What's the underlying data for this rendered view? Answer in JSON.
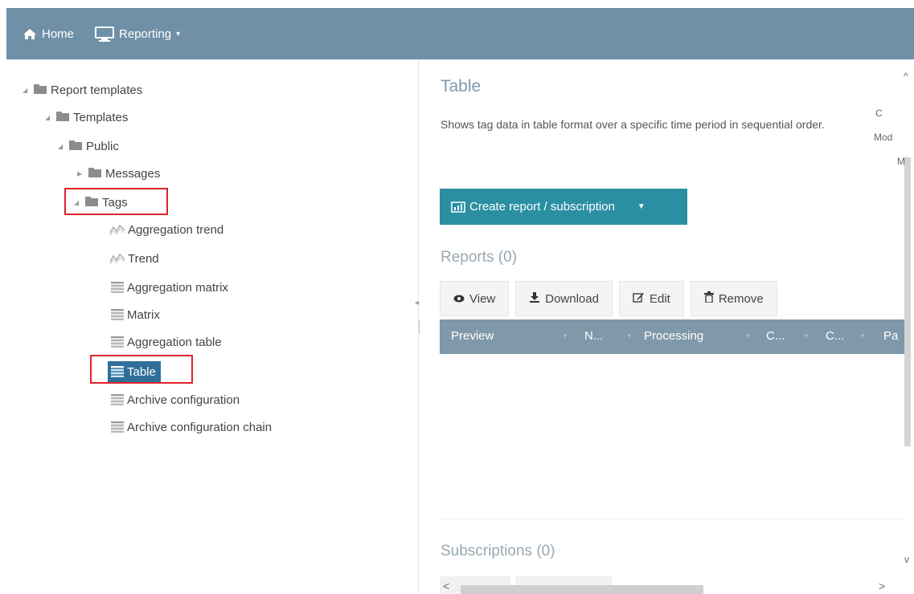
{
  "nav": {
    "home_label": "Home",
    "reporting_label": "Reporting",
    "reporting_caret": "▾"
  },
  "tree": {
    "root": "Report templates",
    "templates": "Templates",
    "public": "Public",
    "messages": "Messages",
    "tags": "Tags",
    "items": [
      {
        "label": "Aggregation trend",
        "icon": "trend-icon"
      },
      {
        "label": "Trend",
        "icon": "trend-icon"
      },
      {
        "label": "Aggregation matrix",
        "icon": "table-icon"
      },
      {
        "label": "Matrix",
        "icon": "table-icon"
      },
      {
        "label": "Aggregation table",
        "icon": "table-icon"
      },
      {
        "label": "Table",
        "icon": "table-icon",
        "selected": true
      },
      {
        "label": "Archive configuration",
        "icon": "table-icon"
      },
      {
        "label": "Archive configuration chain",
        "icon": "table-icon"
      }
    ]
  },
  "detail": {
    "title": "Table",
    "description": "Shows tag data in table format over a specific time period in sequential order.",
    "meta_lines": [
      "C",
      "Mod",
      "M"
    ],
    "create_label": "Create report / subscription",
    "reports_title": "Reports (0)",
    "subscriptions_title": "Subscriptions (0)",
    "toolbar": {
      "view": "View",
      "download": "Download",
      "edit": "Edit",
      "remove": "Remove"
    },
    "columns": [
      "Preview",
      "N...",
      "Processing",
      "C...",
      "C...",
      "Pa"
    ]
  },
  "colors": {
    "topbar": "#6f90a6",
    "accent": "#2b8fa3",
    "grid_header": "#7f98aa",
    "highlight": "#e0232b",
    "selection": "#2f6f9a"
  }
}
